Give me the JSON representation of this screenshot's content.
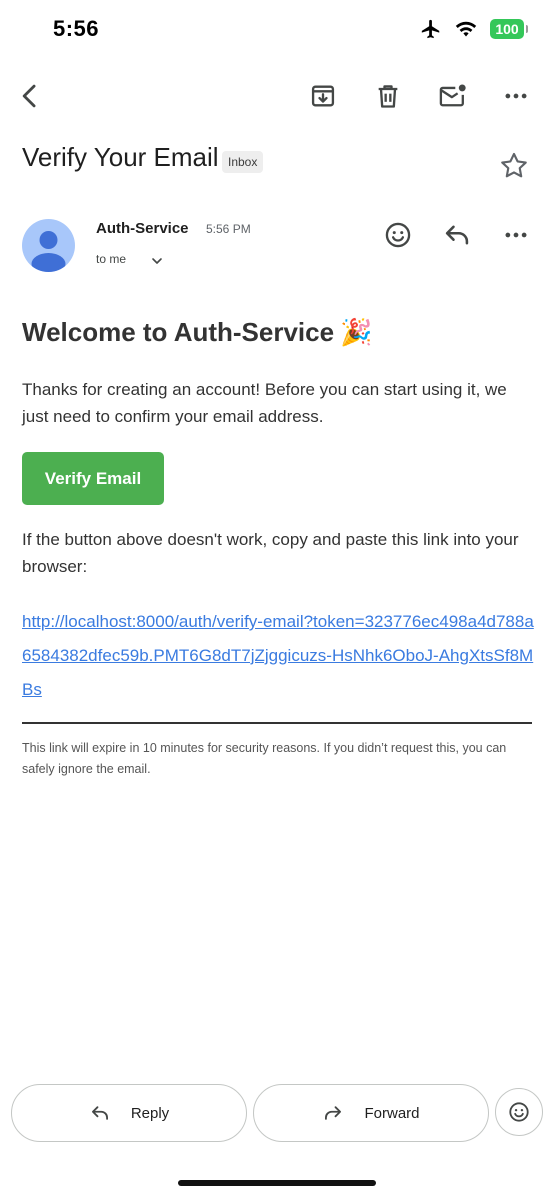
{
  "status_bar": {
    "time": "5:56",
    "battery": "100",
    "icons": [
      "airplane-mode-icon",
      "wifi-icon",
      "battery-icon"
    ]
  },
  "toolbar": {
    "icons": [
      "back-icon",
      "archive-icon",
      "delete-icon",
      "mark-unread-icon",
      "more-icon"
    ]
  },
  "email": {
    "subject": "Verify Your Email",
    "label": "Inbox",
    "sender": "Auth-Service",
    "time": "5:56 PM",
    "recipient": "to me",
    "welcome_heading": "Welcome to Auth-Service",
    "heading_emoji": "🎉",
    "intro": "Thanks for creating an account! Before you can start using it, we just need to confirm your email address.",
    "button_label": "Verify Email",
    "fallback_text": "If the button above doesn't work, copy and paste this link into your browser:",
    "link": "http://localhost:8000/auth/verify-email?token=323776ec498a4d788a6584382dfec59b.PMT6G8dT7jZjggicuzs-HsNhk6OboJ-AhgXtsSf8MBs",
    "footnote": "This link will expire in 10 minutes for security reasons. If you didn’t request this, you can safely ignore the email."
  },
  "actions": {
    "reply_label": "Reply",
    "forward_label": "Forward"
  },
  "colors": {
    "verify_button": "#4caf50",
    "link": "#3a7be0",
    "battery": "#34c759",
    "avatar": "#a8c7fa"
  }
}
